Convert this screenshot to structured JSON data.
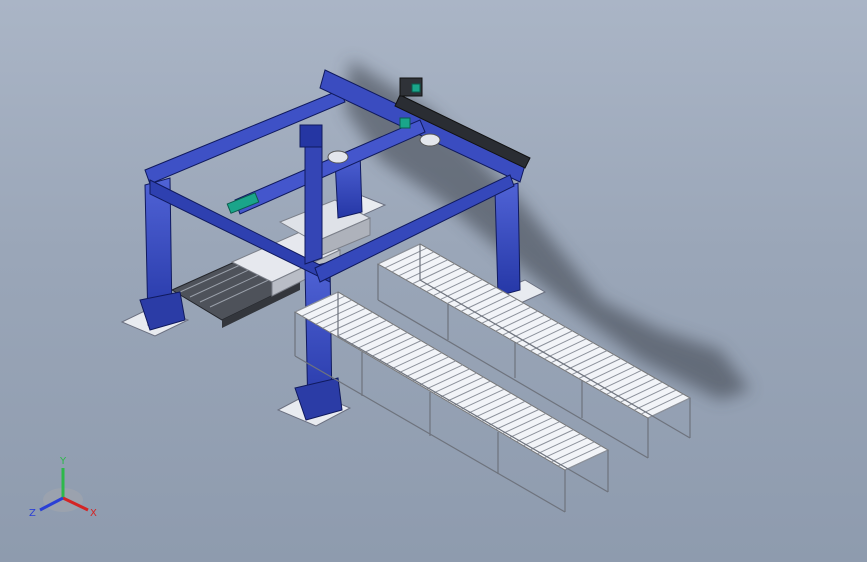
{
  "viewport": {
    "background_top": "#aab5c6",
    "background_bottom": "#8e9bae"
  },
  "model": {
    "frame_color": "#3344b8",
    "frame_dark": "#1f2c8a",
    "roller_color": "#e9ecf2",
    "conveyor_frame_color": "#c8ccd4",
    "pallet_color": "#5a5e66",
    "base_plate_color": "#e8ebf0",
    "accent_color": "#1aa58a"
  },
  "triad": {
    "y_label": "Y",
    "x_label": "X",
    "z_label": "Z",
    "y_color": "#2db84a",
    "x_color": "#d42424",
    "z_color": "#2a3fd6"
  }
}
